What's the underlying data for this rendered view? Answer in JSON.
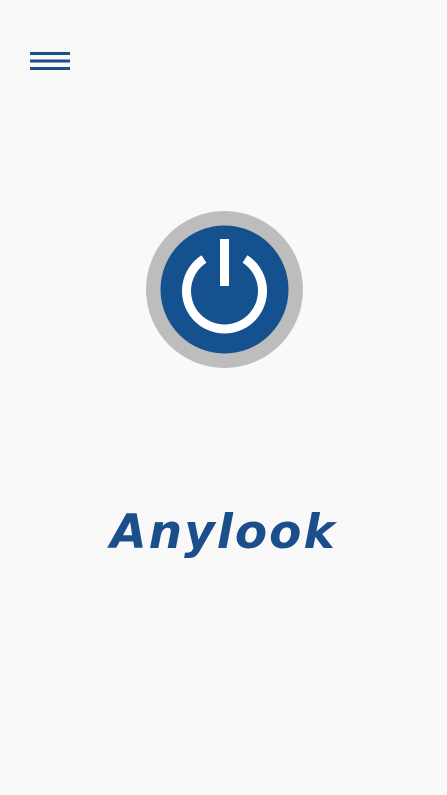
{
  "header": {
    "menu_icon": "hamburger-menu-icon"
  },
  "main": {
    "power_icon": "power-icon",
    "brand_name": "Anylook"
  },
  "colors": {
    "background": "#f9f9f9",
    "brand_blue": "#1b4f8c",
    "ring_gray": "#bdbdbd",
    "power_blue": "#15508f"
  }
}
